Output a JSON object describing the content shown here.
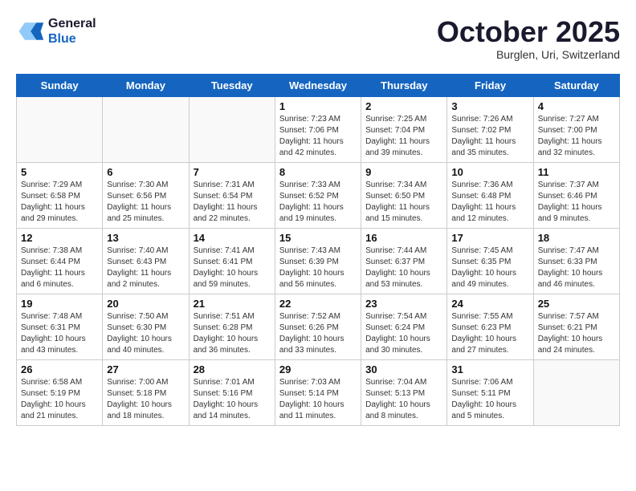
{
  "header": {
    "logo_line1": "General",
    "logo_line2": "Blue",
    "month": "October 2025",
    "location": "Burglen, Uri, Switzerland"
  },
  "weekdays": [
    "Sunday",
    "Monday",
    "Tuesday",
    "Wednesday",
    "Thursday",
    "Friday",
    "Saturday"
  ],
  "weeks": [
    [
      {
        "day": "",
        "info": ""
      },
      {
        "day": "",
        "info": ""
      },
      {
        "day": "",
        "info": ""
      },
      {
        "day": "1",
        "info": "Sunrise: 7:23 AM\nSunset: 7:06 PM\nDaylight: 11 hours and 42 minutes."
      },
      {
        "day": "2",
        "info": "Sunrise: 7:25 AM\nSunset: 7:04 PM\nDaylight: 11 hours and 39 minutes."
      },
      {
        "day": "3",
        "info": "Sunrise: 7:26 AM\nSunset: 7:02 PM\nDaylight: 11 hours and 35 minutes."
      },
      {
        "day": "4",
        "info": "Sunrise: 7:27 AM\nSunset: 7:00 PM\nDaylight: 11 hours and 32 minutes."
      }
    ],
    [
      {
        "day": "5",
        "info": "Sunrise: 7:29 AM\nSunset: 6:58 PM\nDaylight: 11 hours and 29 minutes."
      },
      {
        "day": "6",
        "info": "Sunrise: 7:30 AM\nSunset: 6:56 PM\nDaylight: 11 hours and 25 minutes."
      },
      {
        "day": "7",
        "info": "Sunrise: 7:31 AM\nSunset: 6:54 PM\nDaylight: 11 hours and 22 minutes."
      },
      {
        "day": "8",
        "info": "Sunrise: 7:33 AM\nSunset: 6:52 PM\nDaylight: 11 hours and 19 minutes."
      },
      {
        "day": "9",
        "info": "Sunrise: 7:34 AM\nSunset: 6:50 PM\nDaylight: 11 hours and 15 minutes."
      },
      {
        "day": "10",
        "info": "Sunrise: 7:36 AM\nSunset: 6:48 PM\nDaylight: 11 hours and 12 minutes."
      },
      {
        "day": "11",
        "info": "Sunrise: 7:37 AM\nSunset: 6:46 PM\nDaylight: 11 hours and 9 minutes."
      }
    ],
    [
      {
        "day": "12",
        "info": "Sunrise: 7:38 AM\nSunset: 6:44 PM\nDaylight: 11 hours and 6 minutes."
      },
      {
        "day": "13",
        "info": "Sunrise: 7:40 AM\nSunset: 6:43 PM\nDaylight: 11 hours and 2 minutes."
      },
      {
        "day": "14",
        "info": "Sunrise: 7:41 AM\nSunset: 6:41 PM\nDaylight: 10 hours and 59 minutes."
      },
      {
        "day": "15",
        "info": "Sunrise: 7:43 AM\nSunset: 6:39 PM\nDaylight: 10 hours and 56 minutes."
      },
      {
        "day": "16",
        "info": "Sunrise: 7:44 AM\nSunset: 6:37 PM\nDaylight: 10 hours and 53 minutes."
      },
      {
        "day": "17",
        "info": "Sunrise: 7:45 AM\nSunset: 6:35 PM\nDaylight: 10 hours and 49 minutes."
      },
      {
        "day": "18",
        "info": "Sunrise: 7:47 AM\nSunset: 6:33 PM\nDaylight: 10 hours and 46 minutes."
      }
    ],
    [
      {
        "day": "19",
        "info": "Sunrise: 7:48 AM\nSunset: 6:31 PM\nDaylight: 10 hours and 43 minutes."
      },
      {
        "day": "20",
        "info": "Sunrise: 7:50 AM\nSunset: 6:30 PM\nDaylight: 10 hours and 40 minutes."
      },
      {
        "day": "21",
        "info": "Sunrise: 7:51 AM\nSunset: 6:28 PM\nDaylight: 10 hours and 36 minutes."
      },
      {
        "day": "22",
        "info": "Sunrise: 7:52 AM\nSunset: 6:26 PM\nDaylight: 10 hours and 33 minutes."
      },
      {
        "day": "23",
        "info": "Sunrise: 7:54 AM\nSunset: 6:24 PM\nDaylight: 10 hours and 30 minutes."
      },
      {
        "day": "24",
        "info": "Sunrise: 7:55 AM\nSunset: 6:23 PM\nDaylight: 10 hours and 27 minutes."
      },
      {
        "day": "25",
        "info": "Sunrise: 7:57 AM\nSunset: 6:21 PM\nDaylight: 10 hours and 24 minutes."
      }
    ],
    [
      {
        "day": "26",
        "info": "Sunrise: 6:58 AM\nSunset: 5:19 PM\nDaylight: 10 hours and 21 minutes."
      },
      {
        "day": "27",
        "info": "Sunrise: 7:00 AM\nSunset: 5:18 PM\nDaylight: 10 hours and 18 minutes."
      },
      {
        "day": "28",
        "info": "Sunrise: 7:01 AM\nSunset: 5:16 PM\nDaylight: 10 hours and 14 minutes."
      },
      {
        "day": "29",
        "info": "Sunrise: 7:03 AM\nSunset: 5:14 PM\nDaylight: 10 hours and 11 minutes."
      },
      {
        "day": "30",
        "info": "Sunrise: 7:04 AM\nSunset: 5:13 PM\nDaylight: 10 hours and 8 minutes."
      },
      {
        "day": "31",
        "info": "Sunrise: 7:06 AM\nSunset: 5:11 PM\nDaylight: 10 hours and 5 minutes."
      },
      {
        "day": "",
        "info": ""
      }
    ]
  ]
}
